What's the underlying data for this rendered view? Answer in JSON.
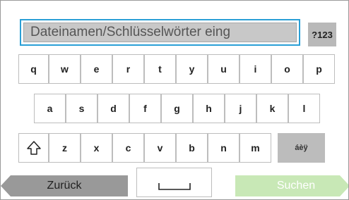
{
  "search": {
    "placeholder": "Dateinamen/Schlüsselwörter eing"
  },
  "keyboard": {
    "symbols_label": "?123",
    "row1": [
      "q",
      "w",
      "e",
      "r",
      "t",
      "y",
      "u",
      "i",
      "o",
      "p"
    ],
    "row2": [
      "a",
      "s",
      "d",
      "f",
      "g",
      "h",
      "j",
      "k",
      "l"
    ],
    "row3": [
      "z",
      "x",
      "c",
      "v",
      "b",
      "n",
      "m"
    ],
    "accents_label": "áèÿ",
    "shift_icon": "shift-arrow-icon",
    "space_icon": "space-bar-icon"
  },
  "footer": {
    "back_label": "Zurück",
    "search_label": "Suchen"
  },
  "colors": {
    "accent_border": "#2a9fd6",
    "back_button": "#999999",
    "search_button": "#c8e8b6",
    "dark_key": "#bcbcbc"
  }
}
